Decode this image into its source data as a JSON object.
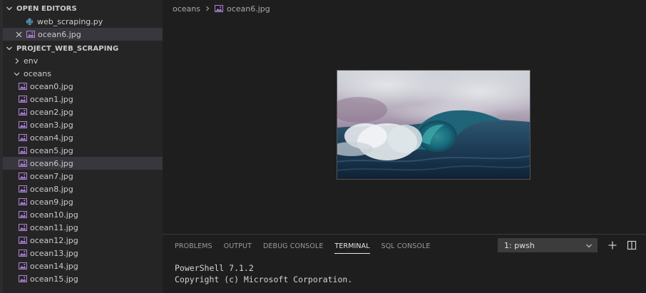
{
  "sidebar": {
    "open_editors": {
      "title": "OPEN EDITORS",
      "items": [
        {
          "label": "web_scraping.py",
          "icon": "python-icon"
        },
        {
          "label": "ocean6.jpg",
          "icon": "image-icon"
        }
      ]
    },
    "project": {
      "title": "PROJECT_WEB_SCRAPING",
      "folders": [
        {
          "label": "env",
          "expanded": false
        },
        {
          "label": "oceans",
          "expanded": true
        }
      ],
      "files": [
        "ocean0.jpg",
        "ocean1.jpg",
        "ocean2.jpg",
        "ocean3.jpg",
        "ocean4.jpg",
        "ocean5.jpg",
        "ocean6.jpg",
        "ocean7.jpg",
        "ocean8.jpg",
        "ocean9.jpg",
        "ocean10.jpg",
        "ocean11.jpg",
        "ocean12.jpg",
        "ocean13.jpg",
        "ocean14.jpg",
        "ocean15.jpg"
      ],
      "selected_file": "ocean6.jpg"
    }
  },
  "editor": {
    "breadcrumb": {
      "folder": "oceans",
      "file": "ocean6.jpg"
    }
  },
  "panel": {
    "tabs": [
      {
        "label": "PROBLEMS",
        "active": false
      },
      {
        "label": "OUTPUT",
        "active": false
      },
      {
        "label": "DEBUG CONSOLE",
        "active": false
      },
      {
        "label": "TERMINAL",
        "active": true
      },
      {
        "label": "SQL CONSOLE",
        "active": false
      }
    ],
    "terminal_select": "1: pwsh",
    "terminal_lines": [
      "PowerShell 7.1.2",
      "Copyright (c) Microsoft Corporation."
    ]
  },
  "colors": {
    "image_icon": "#b180d7",
    "python_icon": "#519aba",
    "selection": "#37373d"
  }
}
